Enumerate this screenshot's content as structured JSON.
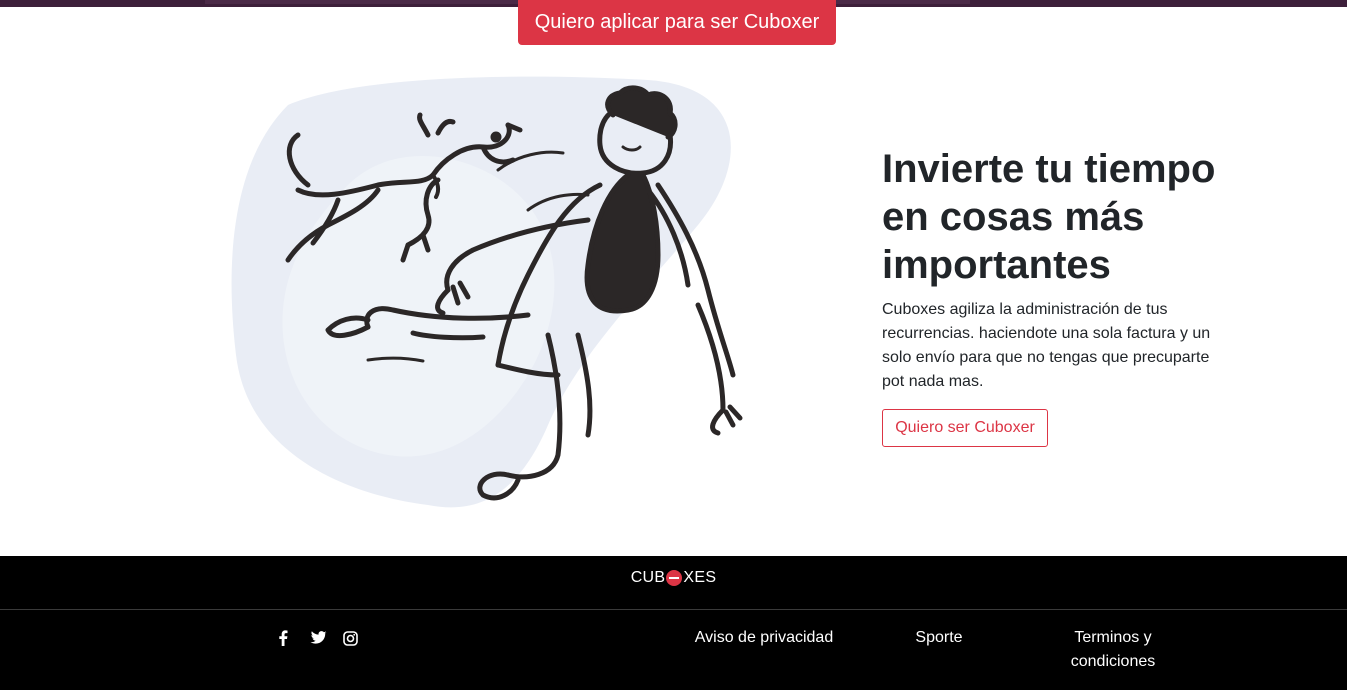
{
  "header": {
    "apply_button_label": "Quiero aplicar para ser Cuboxer"
  },
  "hero": {
    "title": "Invierte tu tiempo en cosas más importantes",
    "description": "Cuboxes agiliza la administración de tus recurrencias. haciendote una sola factura y un solo envío para que no tengas que precuparte pot nada mas.",
    "cta_label": "Quiero ser Cuboxer",
    "illustration": "person-jumping-with-dog-illustration"
  },
  "footer": {
    "brand_prefix": "CUB",
    "brand_suffix": "XES",
    "social_icons": [
      "facebook-icon",
      "twitter-icon",
      "instagram-icon"
    ],
    "links": {
      "privacy": "Aviso de privacidad",
      "support": "Sporte",
      "terms": "Terminos y condiciones"
    }
  },
  "colors": {
    "accent": "#dc3545",
    "header_bar": "#3d1f3a",
    "footer_bg": "#000000",
    "blob": "#e9edf5",
    "ink": "#2b2727"
  }
}
